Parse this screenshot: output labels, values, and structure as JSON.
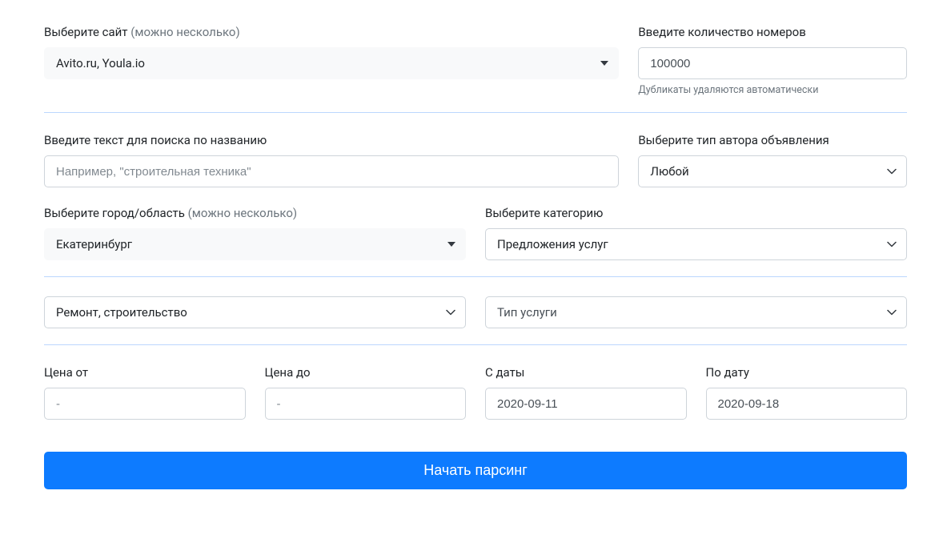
{
  "site": {
    "label_main": "Выберите сайт ",
    "label_hint": "(можно несколько)",
    "value": "Avito.ru, Youla.io"
  },
  "count": {
    "label": "Введите количество номеров",
    "value": "100000",
    "hint": "Дубликаты удаляются автоматически"
  },
  "searchText": {
    "label": "Введите текст для поиска по названию",
    "placeholder": "Например, \"строительная техника\""
  },
  "authorType": {
    "label": "Выберите тип автора объявления",
    "selected": "Любой"
  },
  "city": {
    "label_main": "Выберите город/область ",
    "label_hint": "(можно несколько)",
    "value": "Екатеринбург"
  },
  "category": {
    "label": "Выберите категорию",
    "selected": "Предложения услуг"
  },
  "sub1": {
    "selected": "Ремонт, строительство"
  },
  "sub2": {
    "selected": "Тип услуги"
  },
  "priceFrom": {
    "label": "Цена от",
    "placeholder": "-"
  },
  "priceTo": {
    "label": "Цена до",
    "placeholder": "-"
  },
  "dateFrom": {
    "label": "С даты",
    "value": "2020-09-11"
  },
  "dateTo": {
    "label": "По дату",
    "value": "2020-09-18"
  },
  "submit": "Начать парсинг"
}
